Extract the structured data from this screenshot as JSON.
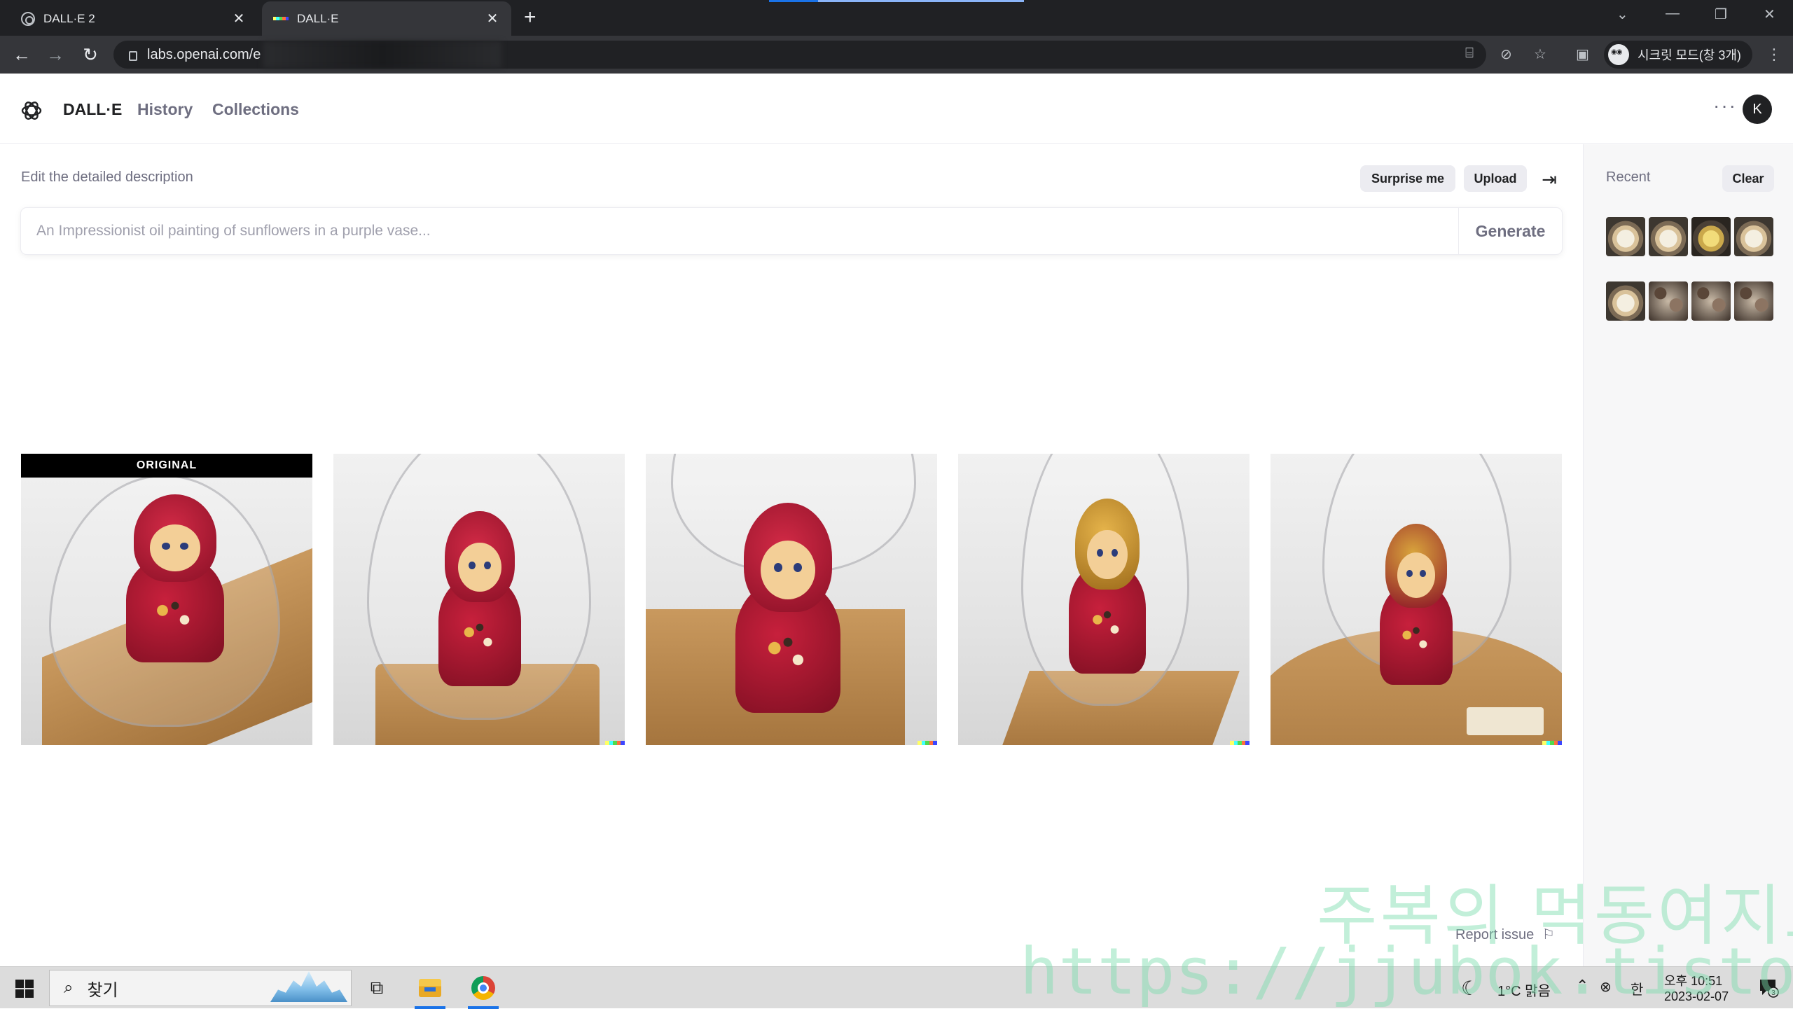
{
  "browser": {
    "tabs": [
      {
        "title": "DALL·E 2",
        "active": false
      },
      {
        "title": "DALL·E",
        "active": true
      }
    ],
    "url": "labs.openai.com/e",
    "profile_label": "시크릿 모드(창 3개)"
  },
  "app": {
    "brand": "DALL·E",
    "nav": {
      "history": "History",
      "collections": "Collections"
    },
    "avatar_initial": "K",
    "more_icon": "more-horizontal-icon"
  },
  "editor": {
    "label": "Edit the detailed description",
    "surprise_label": "Surprise me",
    "upload_label": "Upload",
    "prompt_placeholder": "An Impressionist oil painting of sunflowers in a purple vase...",
    "prompt_value": "",
    "generate_label": "Generate"
  },
  "results": {
    "original_badge": "ORIGINAL",
    "images": [
      {
        "alt": "Original photo of a red matryoshka doll under a wine glass on a wooden board",
        "original": true
      },
      {
        "alt": "Variation 1: red matryoshka doll inside glass dome",
        "original": false
      },
      {
        "alt": "Variation 2: red matryoshka doll under glass on wooden board",
        "original": false
      },
      {
        "alt": "Variation 3: gold-headed matryoshka doll inside tall glass",
        "original": false
      },
      {
        "alt": "Variation 4: red matryoshka doll under glass on round wooden board",
        "original": false
      }
    ],
    "signature_colors": [
      "#ffff66",
      "#42ffff",
      "#51da4c",
      "#ff6e3c",
      "#3c46ff"
    ]
  },
  "recent": {
    "title": "Recent",
    "clear_label": "Clear"
  },
  "footer": {
    "report_issue": "Report issue"
  },
  "watermark": {
    "korean": "주복의 먹동여지도",
    "url": "https://jjubok.tistory.com"
  },
  "taskbar": {
    "search_text": "찾기",
    "weather": "1°C 맑음",
    "ime": "한",
    "time": "오후 10:51",
    "date": "2023-02-07",
    "notification_count": "3"
  }
}
